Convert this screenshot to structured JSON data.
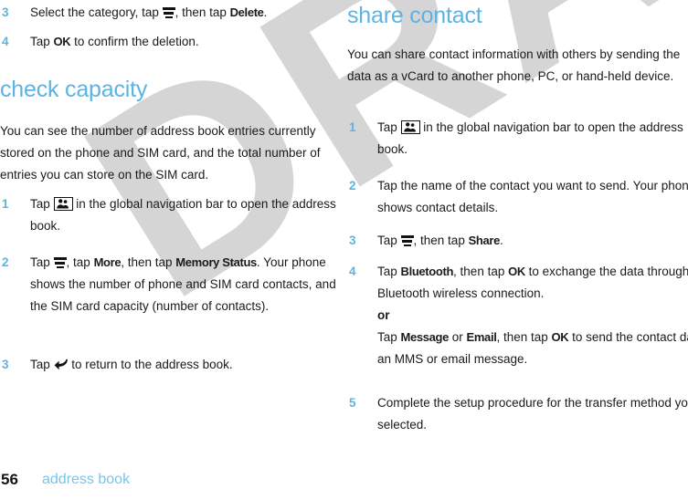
{
  "document": {
    "watermark": "DRAFT",
    "colors": {
      "accent_blue": "#5cb3e4",
      "footer_blue": "#78c4ec",
      "watermark_gray": "#d5d5d5",
      "body_text": "#1a1a1a"
    }
  },
  "footer": {
    "page_number": "56",
    "title": "address book"
  },
  "left_column": {
    "continued_steps": [
      {
        "number": "3",
        "parts": [
          {
            "type": "text",
            "value": "Select the category, tap "
          },
          {
            "type": "icon",
            "value": "menu-key-icon"
          },
          {
            "type": "text",
            "value": ", then tap "
          },
          {
            "type": "bold",
            "value": "Delete"
          },
          {
            "type": "text",
            "value": "."
          }
        ],
        "plain": "Select the category, tap [menu], then tap Delete."
      },
      {
        "number": "4",
        "parts": [
          {
            "type": "text",
            "value": "Tap "
          },
          {
            "type": "bold",
            "value": "OK"
          },
          {
            "type": "text",
            "value": " to confirm the deletion."
          }
        ],
        "plain": "Tap OK to confirm the deletion."
      }
    ],
    "section": {
      "heading": "check capacity",
      "intro": "You can see the number of address book entries currently stored on the phone and SIM card, and the total number of entries you can store on the SIM card.",
      "steps": [
        {
          "number": "1",
          "prefix": "Tap ",
          "icon": "contacts-key-icon",
          "suffix": " in the global navigation bar to open the address book."
        },
        {
          "number": "2",
          "prefix": "Tap ",
          "icon": "menu-key-icon",
          "mid1": ", tap ",
          "bold1": "More",
          "mid2": ", then tap ",
          "bold2": "Memory Status",
          "suffix": ". Your phone shows the number of phone and SIM card contacts, and the SIM card capacity (number of contacts)."
        },
        {
          "number": "3",
          "prefix": "Tap ",
          "icon": "back-arrow-icon",
          "suffix": " to return to the address book."
        }
      ]
    }
  },
  "right_column": {
    "section": {
      "heading": "share contact",
      "intro": "You can share contact information with others by sending the data as a vCard to another phone, PC, or hand-held device.",
      "steps": [
        {
          "number": "1",
          "prefix": "Tap ",
          "icon": "contacts-key-icon",
          "suffix": " in the global navigation bar to open the address book."
        },
        {
          "number": "2",
          "text": "Tap the name of the contact you want to send. Your phone shows contact details."
        },
        {
          "number": "3",
          "prefix": "Tap ",
          "icon": "menu-key-icon",
          "mid1": ", then tap ",
          "bold1": "Share",
          "suffix": "."
        },
        {
          "number": "4",
          "line1_a": "Tap ",
          "line1_b1": "Bluetooth",
          "line1_c": ", then tap ",
          "line1_b2": "OK",
          "line1_d": " to exchange the data through a Bluetooth wireless connection.",
          "or": "or",
          "line2_a": "Tap ",
          "line2_b1": "Message",
          "line2_c": " or ",
          "line2_b2": "Email",
          "line2_d": ", then tap ",
          "line2_b3": "OK",
          "line2_e": " to send the contact data in an MMS or email message."
        },
        {
          "number": "5",
          "text": "Complete the setup procedure for the transfer method you selected."
        }
      ]
    }
  }
}
